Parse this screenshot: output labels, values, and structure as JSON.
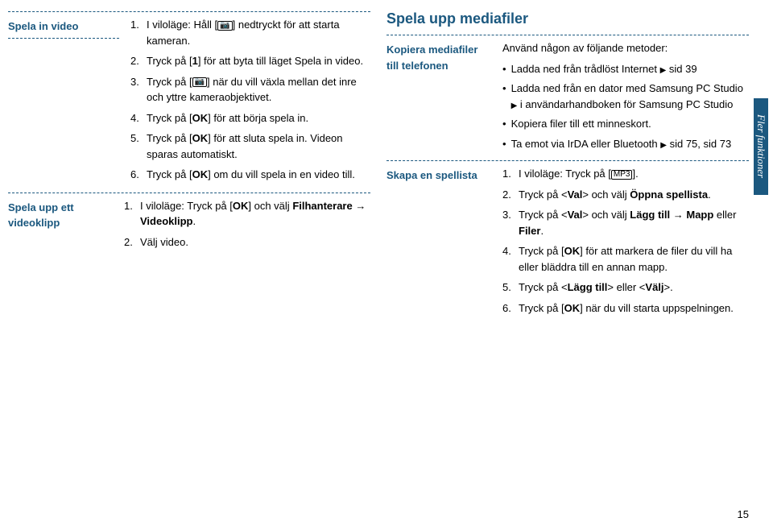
{
  "left": {
    "sec1": {
      "label": "Spela in video",
      "items": [
        {
          "n": "1.",
          "pre": "I viloläge: Håll [",
          "icon": "📷",
          "post": "] nedtryckt för att starta kameran."
        },
        {
          "n": "2.",
          "pre": "Tryck på [",
          "bold": "1",
          "post": "] för att byta till läget Spela in video."
        },
        {
          "n": "3.",
          "pre": "Tryck på [",
          "icon": "📷",
          "post": "] när du vill växla mellan det inre och yttre kameraobjektivet."
        },
        {
          "n": "4.",
          "pre": "Tryck på [",
          "bold": "OK",
          "post": "] för att börja spela in."
        },
        {
          "n": "5.",
          "pre": "Tryck på [",
          "bold": "OK",
          "post": "] för att sluta spela in. Videon sparas automatiskt."
        },
        {
          "n": "6.",
          "pre": "Tryck på [",
          "bold": "OK",
          "post": "] om du vill spela in en video till."
        }
      ]
    },
    "sec2": {
      "label": "Spela upp ett videoklipp",
      "items": [
        {
          "n": "1.",
          "pre": "I viloläge: Tryck på [",
          "bold": "OK",
          "post": "] och välj ",
          "bold2": "Filhanterare",
          "arrow": " → ",
          "bold3": "Videoklipp",
          "tail": "."
        },
        {
          "n": "2.",
          "text": "Välj video."
        }
      ]
    }
  },
  "right": {
    "heading": "Spela upp mediafiler",
    "sec1": {
      "label": "Kopiera mediafiler till telefonen",
      "intro": "Använd någon av följande metoder:",
      "bullets": [
        {
          "text": "Ladda ned från trådlöst Internet",
          "tri": "▶",
          "tail": " sid 39"
        },
        {
          "text": "Ladda ned från en dator med Samsung PC Studio ",
          "tri": "▶",
          "tail": " i användarhandboken för Samsung PC Studio"
        },
        {
          "text": "Kopiera filer till ett minneskort."
        },
        {
          "text": "Ta emot via IrDA eller Bluetooth",
          "tri": "▶",
          "tail": " sid 75, sid 73"
        }
      ]
    },
    "sec2": {
      "label": "Skapa en spellista",
      "items": [
        {
          "n": "1.",
          "pre": "I viloläge: Tryck på [",
          "icon": "MP3",
          "post": "]."
        },
        {
          "n": "2.",
          "pre": "Tryck på <",
          "bold": "Val",
          "mid": "> och välj ",
          "bold2": "Öppna spellista",
          "tail": "."
        },
        {
          "n": "3.",
          "pre": "Tryck på <",
          "bold": "Val",
          "mid": "> och välj ",
          "bold2": "Lägg till",
          "arrow": " → ",
          "bold3": "Mapp",
          "or": " eller ",
          "bold4": "Filer",
          "tail": "."
        },
        {
          "n": "4.",
          "pre": "Tryck på [",
          "bold": "OK",
          "post": "] för att markera de filer du vill ha eller bläddra till en annan mapp."
        },
        {
          "n": "5.",
          "pre": "Tryck på <",
          "bold": "Lägg till",
          "mid": "> eller <",
          "bold2": "Välj",
          "tail": ">."
        },
        {
          "n": "6.",
          "pre": "Tryck på [",
          "bold": "OK",
          "post": "] när du vill starta uppspelningen."
        }
      ]
    }
  },
  "sideTab": "Fler funktioner",
  "pageNumber": "15"
}
